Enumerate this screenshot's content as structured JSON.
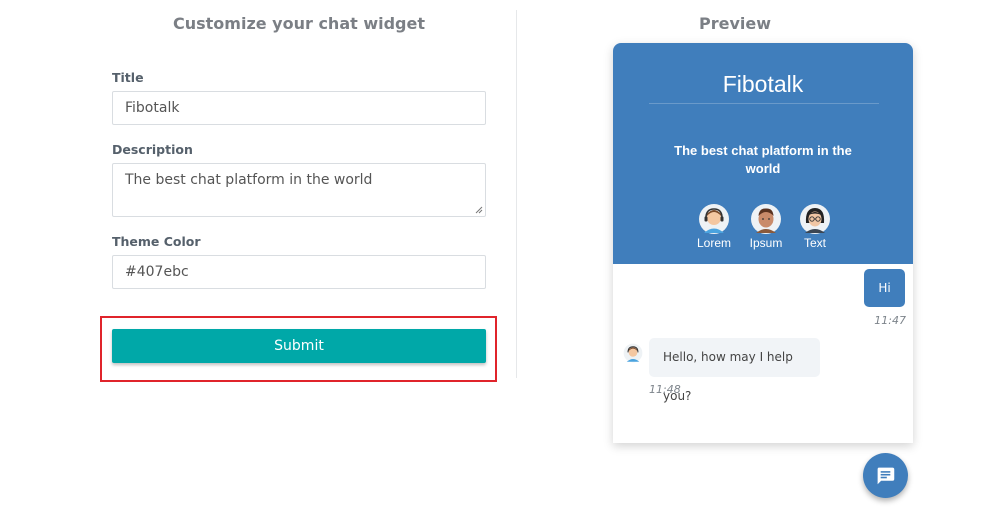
{
  "form": {
    "heading": "Customize your chat widget",
    "title_label": "Title",
    "title_value": "Fibotalk",
    "description_label": "Description",
    "description_value": "The best chat platform in the world",
    "theme_label": "Theme Color",
    "theme_value": "#407ebc",
    "submit_label": "Submit"
  },
  "preview": {
    "heading": "Preview",
    "widget_title": "Fibotalk",
    "widget_description": "The best chat platform in the world",
    "theme_color": "#407ebc",
    "agents": [
      {
        "name": "Lorem",
        "icon": "agent-headset-avatar-icon"
      },
      {
        "name": "Ipsum",
        "icon": "agent-man-avatar-icon"
      },
      {
        "name": "Text",
        "icon": "agent-woman-glasses-avatar-icon"
      }
    ],
    "messages": [
      {
        "from": "user",
        "text": "Hi",
        "time": "11:47"
      },
      {
        "from": "agent",
        "text": "Hello, how may I help you?",
        "time": "11:48"
      }
    ],
    "launcher_icon": "chat-bubble-icon"
  }
}
